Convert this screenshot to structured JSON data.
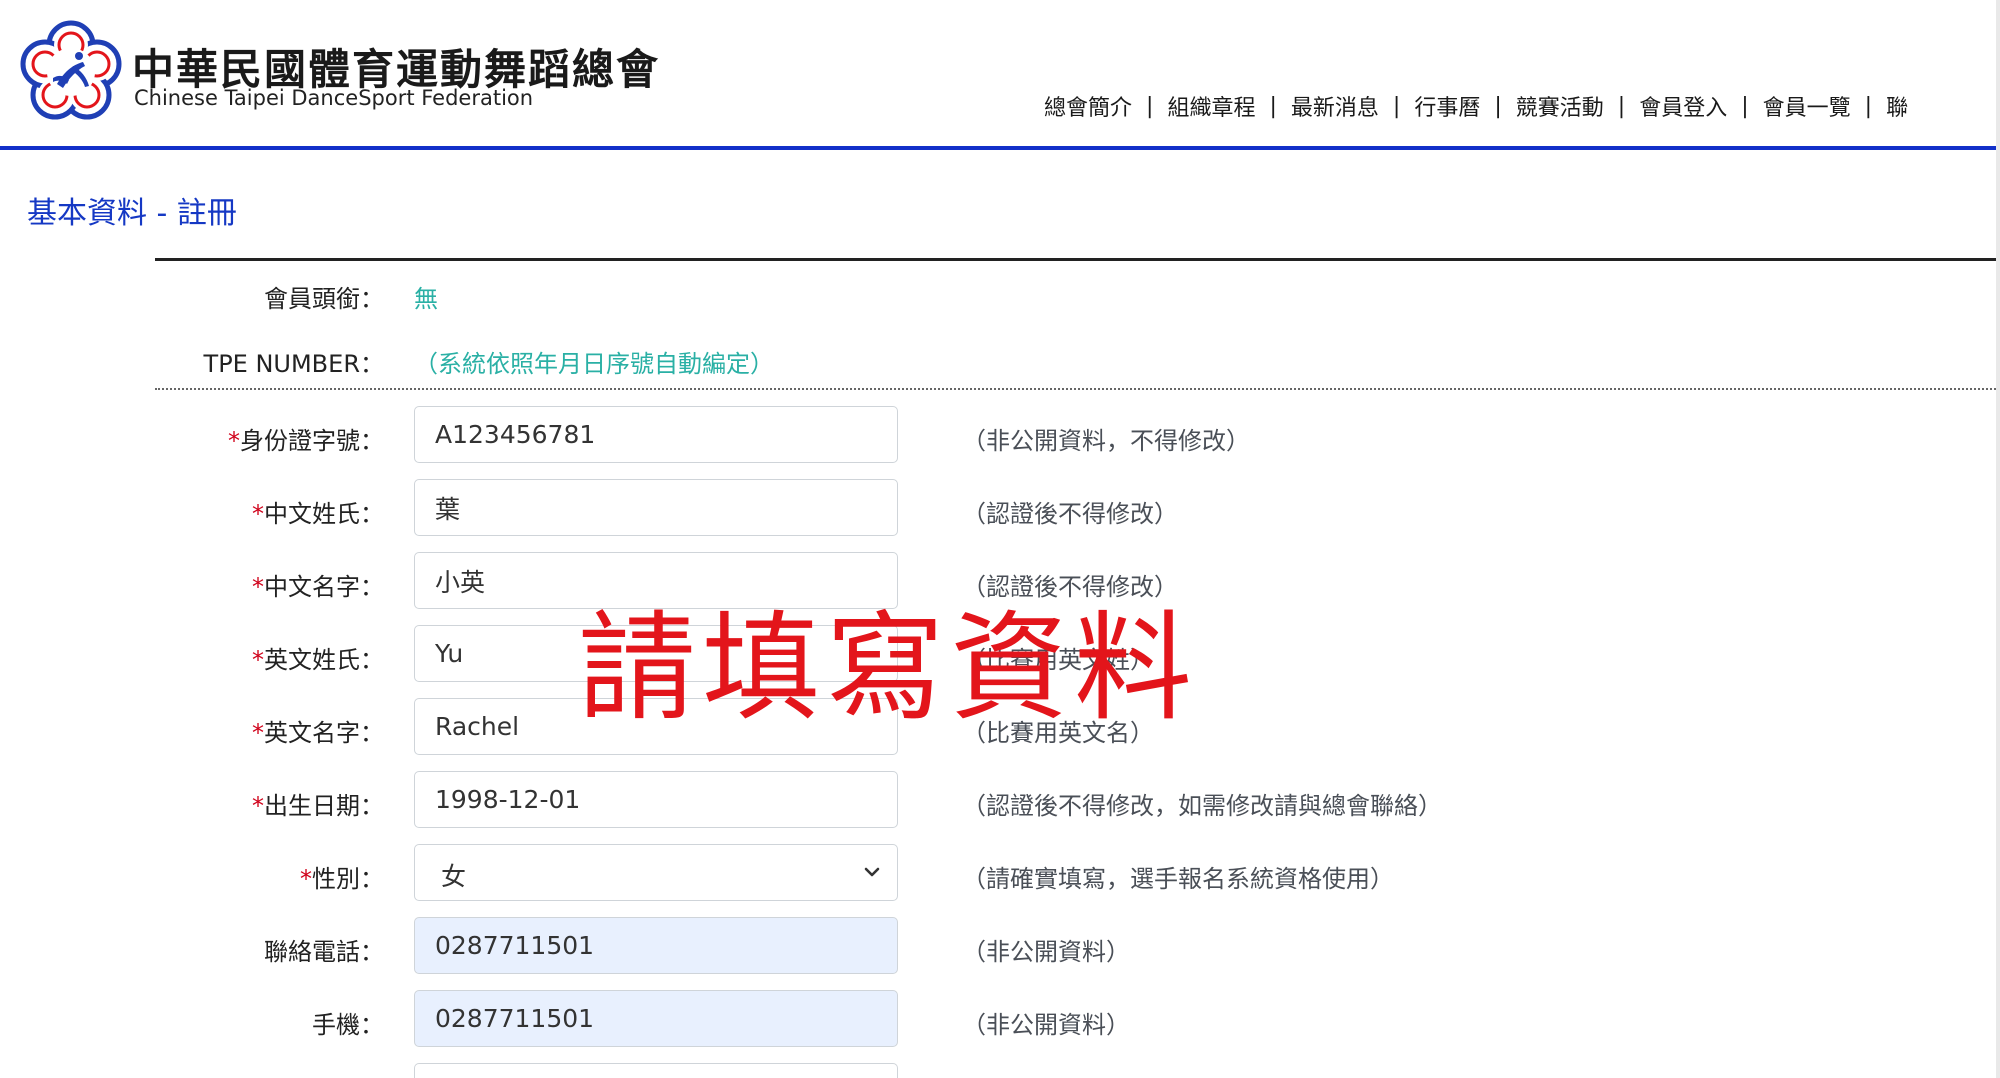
{
  "header": {
    "title": "中華民國體育運動舞蹈總會",
    "subtitle": "Chinese Taipei DanceSport Federation",
    "nav": [
      "總會簡介",
      "組織章程",
      "最新消息",
      "行事曆",
      "競賽活動",
      "會員登入",
      "會員一覽",
      "聯"
    ],
    "nav_separator": "|"
  },
  "page_heading": "基本資料 - 註冊",
  "info_rows": [
    {
      "label": "會員頭銜：",
      "value": "無"
    },
    {
      "label": "TPE NUMBER：",
      "value": "（系統依照年月日序號自動編定）"
    }
  ],
  "required_mark": "*",
  "form": {
    "id_number": {
      "label": "身份證字號：",
      "value": "A123456781",
      "hint": "（非公開資料，不得修改）",
      "required": true
    },
    "cn_surname": {
      "label": "中文姓氏：",
      "value": "葉",
      "hint": "（認證後不得修改）",
      "required": true
    },
    "cn_given": {
      "label": "中文名字：",
      "value": "小英",
      "hint": "（認證後不得修改）",
      "required": true
    },
    "en_surname": {
      "label": "英文姓氏：",
      "value": "Yu",
      "hint": "（比賽用英文姓）",
      "required": true
    },
    "en_given": {
      "label": "英文名字：",
      "value": "Rachel",
      "hint": "（比賽用英文名）",
      "required": true
    },
    "birthdate": {
      "label": "出生日期：",
      "value": "1998-12-01",
      "hint": "（認證後不得修改，如需修改請與總會聯絡）",
      "required": true
    },
    "gender": {
      "label": "性別：",
      "value": "女",
      "hint": "（請確實填寫，選手報名系統資格使用）",
      "required": true
    },
    "phone": {
      "label": "聯絡電話：",
      "value": "0287711501",
      "hint": "（非公開資料）",
      "required": false
    },
    "mobile": {
      "label": "手機：",
      "value": "0287711501",
      "hint": "（非公開資料）",
      "required": false
    },
    "next_field": {
      "value": ""
    }
  },
  "overlay": "請填寫資料",
  "colors": {
    "accent_blue": "#1538c4",
    "header_rule": "#1230c9",
    "teal_text": "#2ab0a5",
    "required_red": "#d0021b",
    "overlay_red": "#e3151b",
    "autofill_bg": "#e8f0fe"
  },
  "icons": {
    "logo": "plum-blossom-dancer-logo",
    "select_arrow": "chevron-down-icon"
  }
}
